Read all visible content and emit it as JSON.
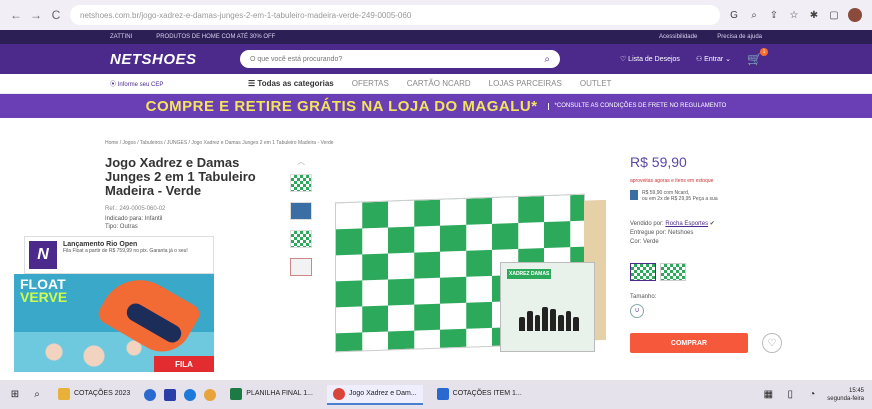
{
  "browser": {
    "url": "netshoes.com.br/jogo-xadrez-e-damas-junges-2-em-1-tabuleiro-madeira-verde-249-0005-060",
    "back_icon": "←",
    "forward_icon": "→",
    "reload_icon": "C"
  },
  "topstrip": {
    "brand": "ZATTINI",
    "promo": "PRODUTOS DE HOME COM ATÉ 30% OFF",
    "acc": "Acessibilidade",
    "help": "Precisa de ajuda"
  },
  "header": {
    "logo": "NETSHOES",
    "search_placeholder": "O que você está procurando?",
    "wishlist": "Lista de Desejos",
    "login": "Entrar",
    "cart_count": "1"
  },
  "catnav": {
    "location": "Informe seu CEP",
    "all": "Todas as categorias",
    "items": [
      "OFERTAS",
      "CARTÃO NCARD",
      "LOJAS PARCEIRAS",
      "OUTLET"
    ]
  },
  "banner": {
    "main": "COMPRE E RETIRE GRÁTIS NA LOJA DO MAGALU*",
    "note": "*CONSULTE AS CONDIÇÕES DE FRETE NO REGULAMENTO"
  },
  "product": {
    "breadcrumb": "Home / Jogos / Tabuleiros / JUNGES / Jogo Xadrez e Damas Junges 2 em 1 Tabuleiro Madeira - Verde",
    "title": "Jogo Xadrez e Damas Junges 2 em 1 Tabuleiro Madeira - Verde",
    "ref": "Ref.: 249-0005-060-02",
    "tag1": "Indicado para: Infantil",
    "tag2": "Tipo: Outras",
    "box_label": "XADREZ DAMAS",
    "price": "R$ 59,90",
    "price_note": "aproveitas agoras e itens em estoque",
    "pay_line1": "R$ 59,90 com Ncard,",
    "pay_line2": "ou em 2x de R$ 29,95 Peça a sua",
    "seller_label": "Vendido por:",
    "seller_name": "Rocha Esportes",
    "delivery": "Entregue por: Netshoes",
    "color_label": "Cor: Verde",
    "size_label": "Tamanho:",
    "size_value": "U",
    "buy": "COMPRAR",
    "heart_icon": "♡"
  },
  "notification": {
    "logo": "N",
    "title": "Lançamento Rio Open",
    "desc": "Fila Float a partir de R$ 759,99 no pix. Garanta já o seu!"
  },
  "ad": {
    "line1": "FLOAT",
    "line2": "VERVE",
    "brand": "FILA"
  },
  "taskbar": {
    "app1": "COTAÇÕES 2023",
    "app2": "PLANILHA FINAL 1...",
    "app3": "Jogo Xadrez e Dam...",
    "app4": "COTAÇÕES ITEM 1...",
    "time": "15:45",
    "day": "segunda-feira"
  }
}
